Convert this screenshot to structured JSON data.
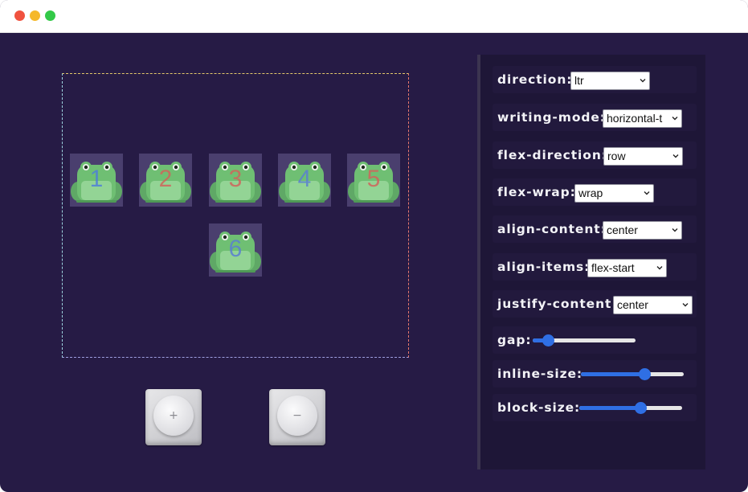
{
  "frogs": [
    "1",
    "2",
    "3",
    "4",
    "5",
    "6"
  ],
  "frog_number_colors": [
    "#4f7fd8",
    "#d0655c",
    "#d0655c",
    "#5a7fd2",
    "#d0655c",
    "#5a7fd2"
  ],
  "buttons": {
    "add_glyph": "+",
    "remove_glyph": "−"
  },
  "controls": {
    "direction": {
      "label": "direction:",
      "value": "ltr"
    },
    "writing_mode": {
      "label": "writing-mode:",
      "value": "horizontal-t"
    },
    "flex_direction": {
      "label": "flex-direction:",
      "value": "row"
    },
    "flex_wrap": {
      "label": "flex-wrap:",
      "value": "wrap"
    },
    "align_content": {
      "label": "align-content:",
      "value": "center"
    },
    "align_items": {
      "label": "align-items:",
      "value": "flex-start"
    },
    "justify_content": {
      "label": "justify-content:",
      "value": "center"
    },
    "gap": {
      "label": "gap:",
      "level": 0.15
    },
    "inline_size": {
      "label": "inline-size:",
      "level": 0.62
    },
    "block_size": {
      "label": "block-size:",
      "level": 0.59
    }
  },
  "colors": {
    "background": "#261b45",
    "panel": "#1e1637",
    "accent": "#2f6fe4",
    "frog": "#6fbf73"
  }
}
